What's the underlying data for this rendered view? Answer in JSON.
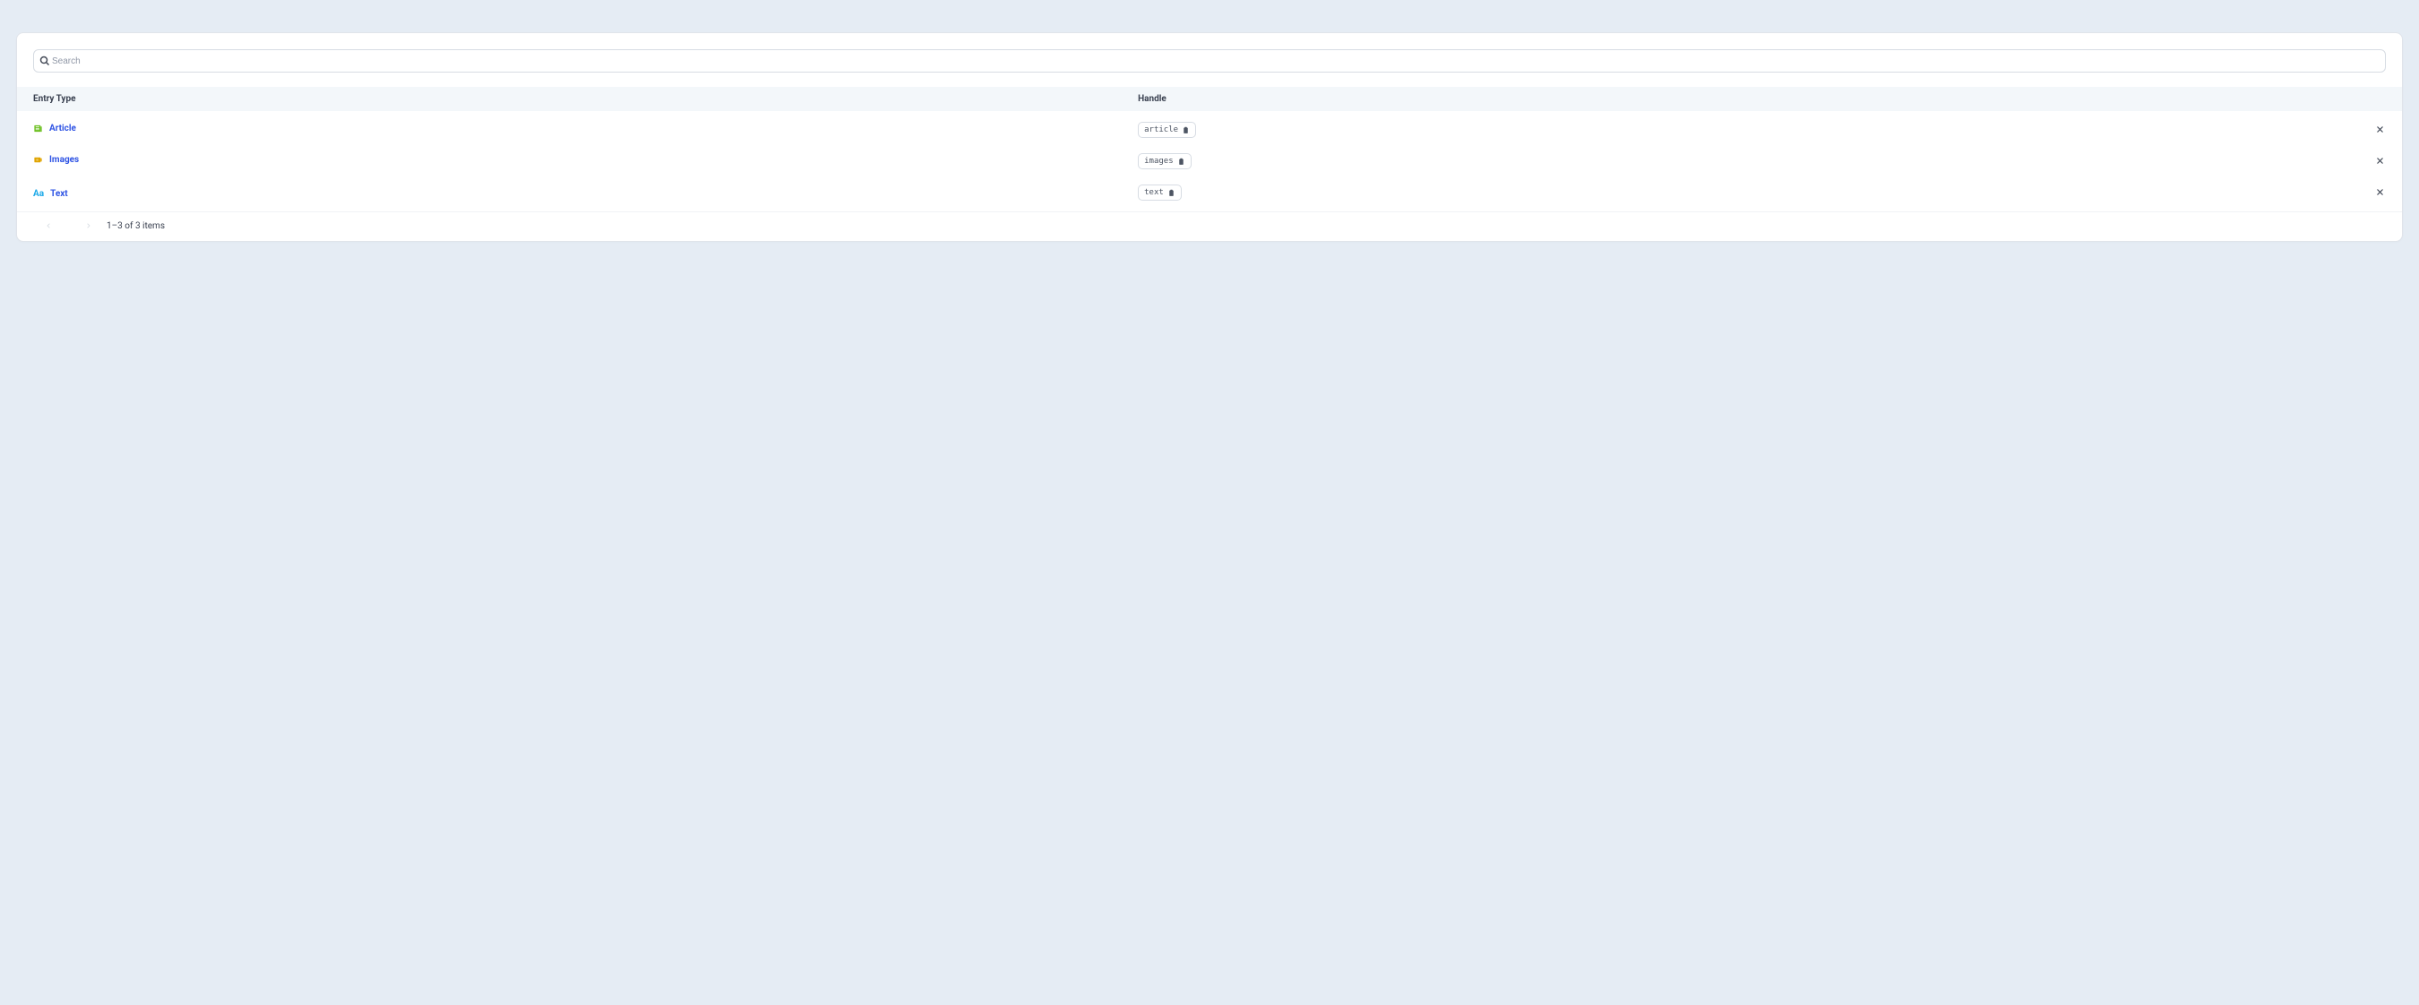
{
  "search": {
    "placeholder": "Search",
    "value": ""
  },
  "columns": {
    "type": "Entry Type",
    "handle": "Handle"
  },
  "rows": [
    {
      "label": "Article",
      "handle": "article",
      "icon": "newspaper",
      "icon_color": "#6bbf1f"
    },
    {
      "label": "Images",
      "handle": "images",
      "icon": "camera",
      "icon_color": "#e0a400"
    },
    {
      "label": "Text",
      "handle": "text",
      "icon": "Aa",
      "icon_color": "#1aa8e8"
    }
  ],
  "pagination": {
    "summary": "1–3 of 3 items"
  }
}
